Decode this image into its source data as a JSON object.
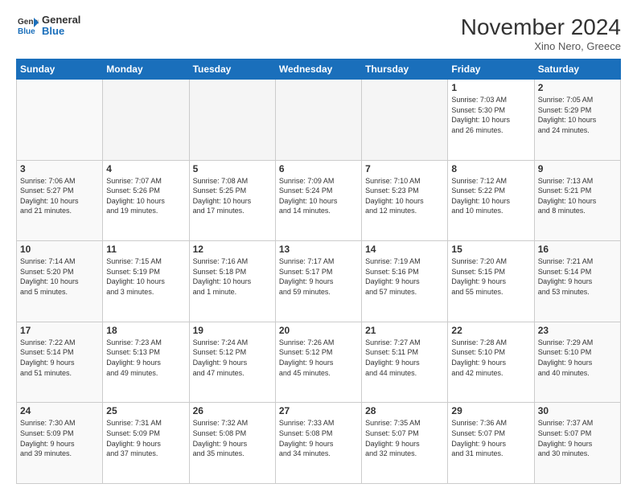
{
  "logo": {
    "text_general": "General",
    "text_blue": "Blue"
  },
  "header": {
    "month": "November 2024",
    "location": "Xino Nero, Greece"
  },
  "weekdays": [
    "Sunday",
    "Monday",
    "Tuesday",
    "Wednesday",
    "Thursday",
    "Friday",
    "Saturday"
  ],
  "weeks": [
    [
      {
        "day": "",
        "info": ""
      },
      {
        "day": "",
        "info": ""
      },
      {
        "day": "",
        "info": ""
      },
      {
        "day": "",
        "info": ""
      },
      {
        "day": "",
        "info": ""
      },
      {
        "day": "1",
        "info": "Sunrise: 7:03 AM\nSunset: 5:30 PM\nDaylight: 10 hours\nand 26 minutes."
      },
      {
        "day": "2",
        "info": "Sunrise: 7:05 AM\nSunset: 5:29 PM\nDaylight: 10 hours\nand 24 minutes."
      }
    ],
    [
      {
        "day": "3",
        "info": "Sunrise: 7:06 AM\nSunset: 5:27 PM\nDaylight: 10 hours\nand 21 minutes."
      },
      {
        "day": "4",
        "info": "Sunrise: 7:07 AM\nSunset: 5:26 PM\nDaylight: 10 hours\nand 19 minutes."
      },
      {
        "day": "5",
        "info": "Sunrise: 7:08 AM\nSunset: 5:25 PM\nDaylight: 10 hours\nand 17 minutes."
      },
      {
        "day": "6",
        "info": "Sunrise: 7:09 AM\nSunset: 5:24 PM\nDaylight: 10 hours\nand 14 minutes."
      },
      {
        "day": "7",
        "info": "Sunrise: 7:10 AM\nSunset: 5:23 PM\nDaylight: 10 hours\nand 12 minutes."
      },
      {
        "day": "8",
        "info": "Sunrise: 7:12 AM\nSunset: 5:22 PM\nDaylight: 10 hours\nand 10 minutes."
      },
      {
        "day": "9",
        "info": "Sunrise: 7:13 AM\nSunset: 5:21 PM\nDaylight: 10 hours\nand 8 minutes."
      }
    ],
    [
      {
        "day": "10",
        "info": "Sunrise: 7:14 AM\nSunset: 5:20 PM\nDaylight: 10 hours\nand 5 minutes."
      },
      {
        "day": "11",
        "info": "Sunrise: 7:15 AM\nSunset: 5:19 PM\nDaylight: 10 hours\nand 3 minutes."
      },
      {
        "day": "12",
        "info": "Sunrise: 7:16 AM\nSunset: 5:18 PM\nDaylight: 10 hours\nand 1 minute."
      },
      {
        "day": "13",
        "info": "Sunrise: 7:17 AM\nSunset: 5:17 PM\nDaylight: 9 hours\nand 59 minutes."
      },
      {
        "day": "14",
        "info": "Sunrise: 7:19 AM\nSunset: 5:16 PM\nDaylight: 9 hours\nand 57 minutes."
      },
      {
        "day": "15",
        "info": "Sunrise: 7:20 AM\nSunset: 5:15 PM\nDaylight: 9 hours\nand 55 minutes."
      },
      {
        "day": "16",
        "info": "Sunrise: 7:21 AM\nSunset: 5:14 PM\nDaylight: 9 hours\nand 53 minutes."
      }
    ],
    [
      {
        "day": "17",
        "info": "Sunrise: 7:22 AM\nSunset: 5:14 PM\nDaylight: 9 hours\nand 51 minutes."
      },
      {
        "day": "18",
        "info": "Sunrise: 7:23 AM\nSunset: 5:13 PM\nDaylight: 9 hours\nand 49 minutes."
      },
      {
        "day": "19",
        "info": "Sunrise: 7:24 AM\nSunset: 5:12 PM\nDaylight: 9 hours\nand 47 minutes."
      },
      {
        "day": "20",
        "info": "Sunrise: 7:26 AM\nSunset: 5:12 PM\nDaylight: 9 hours\nand 45 minutes."
      },
      {
        "day": "21",
        "info": "Sunrise: 7:27 AM\nSunset: 5:11 PM\nDaylight: 9 hours\nand 44 minutes."
      },
      {
        "day": "22",
        "info": "Sunrise: 7:28 AM\nSunset: 5:10 PM\nDaylight: 9 hours\nand 42 minutes."
      },
      {
        "day": "23",
        "info": "Sunrise: 7:29 AM\nSunset: 5:10 PM\nDaylight: 9 hours\nand 40 minutes."
      }
    ],
    [
      {
        "day": "24",
        "info": "Sunrise: 7:30 AM\nSunset: 5:09 PM\nDaylight: 9 hours\nand 39 minutes."
      },
      {
        "day": "25",
        "info": "Sunrise: 7:31 AM\nSunset: 5:09 PM\nDaylight: 9 hours\nand 37 minutes."
      },
      {
        "day": "26",
        "info": "Sunrise: 7:32 AM\nSunset: 5:08 PM\nDaylight: 9 hours\nand 35 minutes."
      },
      {
        "day": "27",
        "info": "Sunrise: 7:33 AM\nSunset: 5:08 PM\nDaylight: 9 hours\nand 34 minutes."
      },
      {
        "day": "28",
        "info": "Sunrise: 7:35 AM\nSunset: 5:07 PM\nDaylight: 9 hours\nand 32 minutes."
      },
      {
        "day": "29",
        "info": "Sunrise: 7:36 AM\nSunset: 5:07 PM\nDaylight: 9 hours\nand 31 minutes."
      },
      {
        "day": "30",
        "info": "Sunrise: 7:37 AM\nSunset: 5:07 PM\nDaylight: 9 hours\nand 30 minutes."
      }
    ]
  ]
}
